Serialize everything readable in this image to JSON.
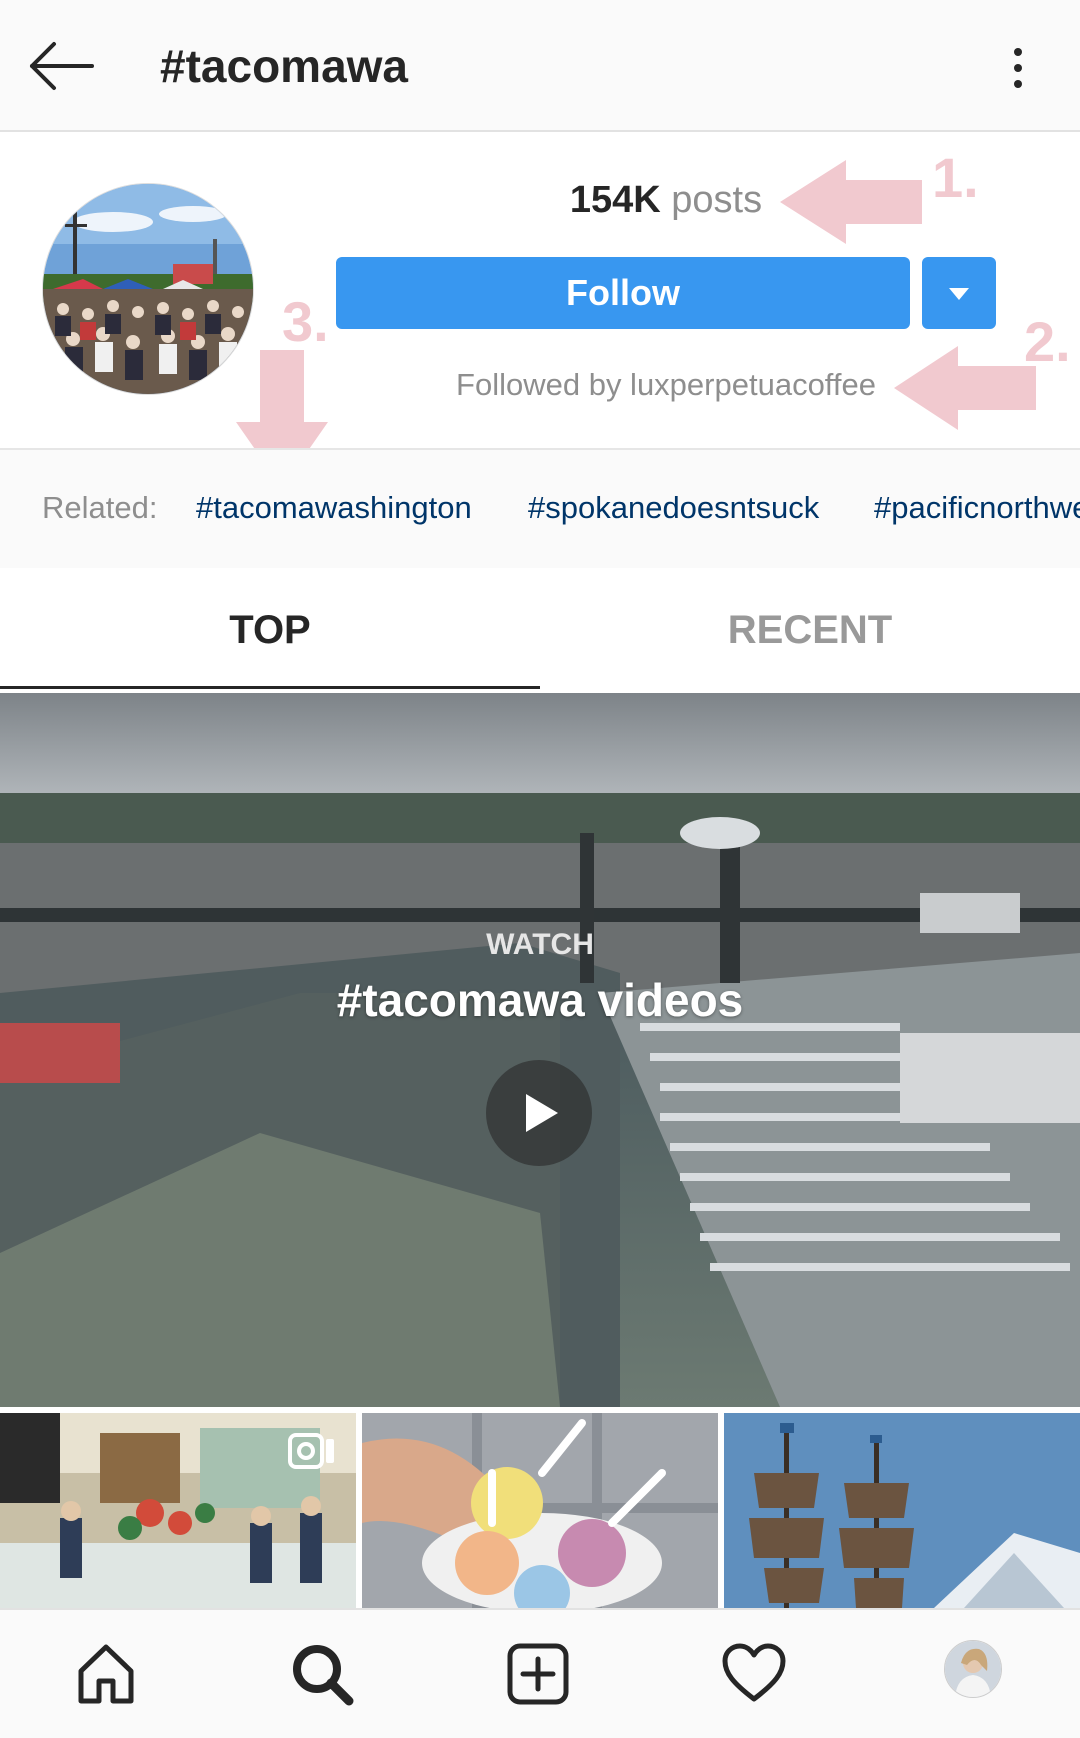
{
  "header": {
    "title": "#tacomawa",
    "back_icon": "arrow-left-icon",
    "more_icon": "kebab-menu-icon"
  },
  "profile": {
    "posts_count": "154K",
    "posts_label": "posts",
    "follow_label": "Follow",
    "followed_by": "Followed by luxperpetuacoffee"
  },
  "annotations": [
    "1.",
    "2.",
    "3."
  ],
  "related": {
    "label": "Related:",
    "tags": [
      "#tacomawashington",
      "#spokanedoesntsuck",
      "#pacificnorthwest"
    ]
  },
  "tabs": [
    {
      "label": "TOP",
      "active": true
    },
    {
      "label": "RECENT",
      "active": false
    }
  ],
  "hero": {
    "watch_label": "WATCH",
    "title": "#tacomawa videos"
  },
  "nav": {
    "items": [
      "home-icon",
      "search-icon",
      "add-post-icon",
      "heart-icon",
      "profile-avatar"
    ]
  },
  "colors": {
    "follow_blue": "#3897f0",
    "tag_blue": "#003569",
    "annotation_pink": "#f1c9cf"
  }
}
